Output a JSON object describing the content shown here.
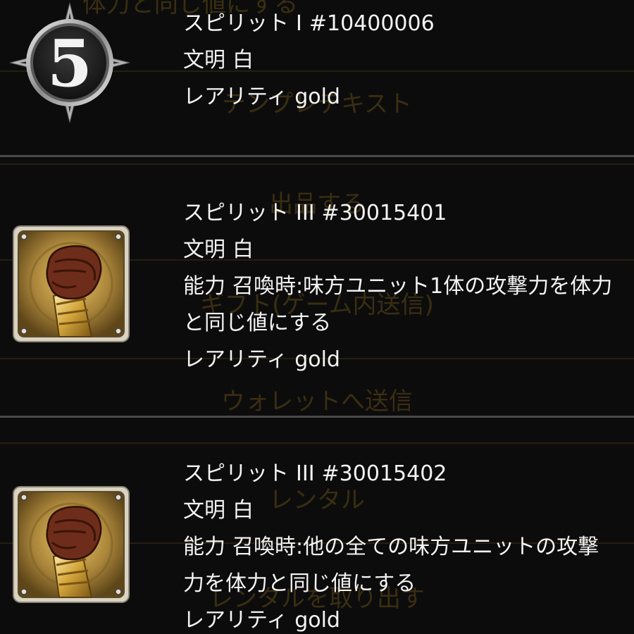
{
  "background_menu": {
    "items": [
      "体力と同じ値にする",
      "テンプレテキスト",
      "出品する",
      "ギフト(ゲーム内送信)",
      "ウォレットへ送信",
      "レンタル",
      "レンタルを取り出す"
    ]
  },
  "cards": [
    {
      "icon": "number-5-medallion-icon",
      "badge_number": "5",
      "name_label": "スピリット",
      "tier": "I",
      "id": "#10400006",
      "civilization_label": "文明",
      "civilization": "白",
      "ability_label": "",
      "ability": "",
      "rarity_label": "レアリティ",
      "rarity": "gold"
    },
    {
      "icon": "raised-fist-icon",
      "name_label": "スピリット",
      "tier": "III",
      "id": "#30015401",
      "civilization_label": "文明",
      "civilization": "白",
      "ability_label": "能力",
      "ability": "召喚時:味方ユニット1体の攻撃力を体力と同じ値にする",
      "rarity_label": "レアリティ",
      "rarity": "gold"
    },
    {
      "icon": "raised-fist-icon",
      "name_label": "スピリット",
      "tier": "III",
      "id": "#30015402",
      "civilization_label": "文明",
      "civilization": "白",
      "ability_label": "能力",
      "ability": "召喚時:他の全ての味方ユニットの攻撃力を体力と同じ値にする",
      "rarity_label": "レアリティ",
      "rarity": "gold"
    }
  ],
  "colors": {
    "background": "#0c0c0c",
    "text": "#f4f4f4",
    "divider": "#4a4a4a",
    "ghost_menu_text": "#4a3a14",
    "gold": "#c9a24a"
  }
}
